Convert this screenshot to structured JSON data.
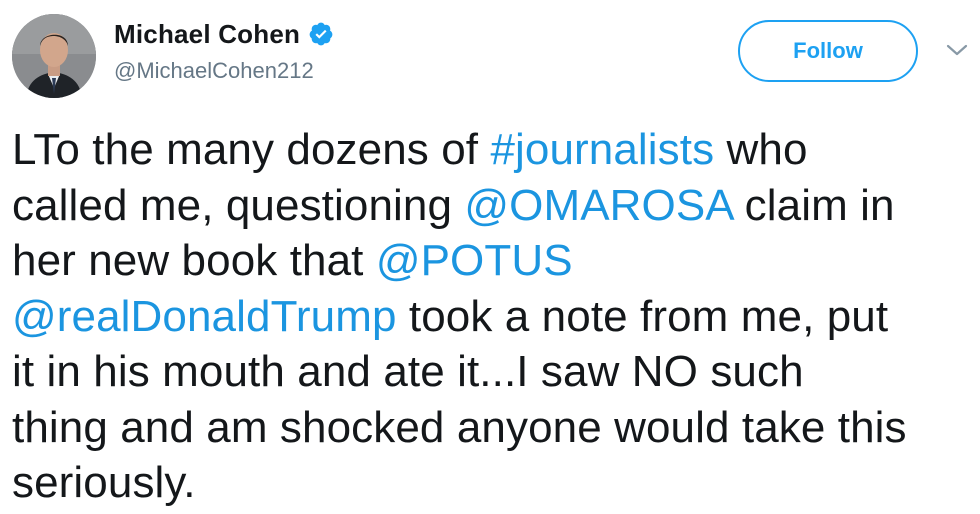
{
  "author": {
    "display_name": "Michael Cohen",
    "handle": "@MichaelCohen212",
    "verified_icon": "verified-badge-icon",
    "avatar_icon": "profile-photo"
  },
  "actions": {
    "follow_label": "Follow",
    "menu_icon": "chevron-down-icon"
  },
  "colors": {
    "accent": "#1da1f2",
    "link": "#1b95e0",
    "text": "#14171a",
    "secondary_text": "#657786"
  },
  "tweet": {
    "lines": [
      [
        {
          "text": "LTo the many dozens of "
        },
        {
          "text": "#journalists",
          "link": true
        },
        {
          "text": " who"
        }
      ],
      [
        {
          "text": "called me, questioning "
        },
        {
          "text": "@OMAROSA",
          "link": true
        },
        {
          "text": " claim in"
        }
      ],
      [
        {
          "text": "her new book that "
        },
        {
          "text": "@POTUS",
          "link": true
        }
      ],
      [
        {
          "text": "@realDonaldTrump",
          "link": true
        },
        {
          "text": " took a note from me, put"
        }
      ],
      [
        {
          "text": "it in his mouth and ate it...I saw NO such"
        }
      ],
      [
        {
          "text": "thing and am shocked anyone would take this"
        }
      ],
      [
        {
          "text": "seriously."
        }
      ]
    ]
  }
}
